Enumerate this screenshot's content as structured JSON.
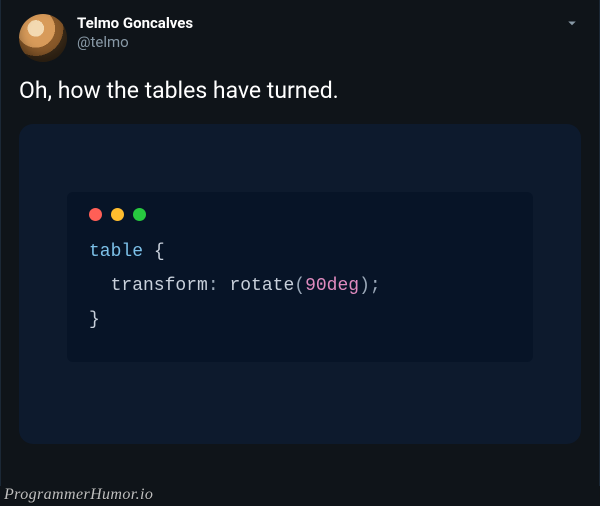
{
  "tweet": {
    "author": {
      "display_name": "Telmo Goncalves",
      "handle": "@telmo"
    },
    "text": "Oh, how the tables have turned."
  },
  "code": {
    "selector": "table",
    "open_brace": "{",
    "property": "transform",
    "colon": ":",
    "func": "rotate",
    "open_paren": "(",
    "value": "90deg",
    "close_paren": ")",
    "semicolon": ";",
    "close_brace": "}"
  },
  "icons": {
    "traffic_red": "close-icon",
    "traffic_yellow": "minimize-icon",
    "traffic_green": "zoom-icon"
  },
  "watermark": "ProgrammerHumor.io"
}
